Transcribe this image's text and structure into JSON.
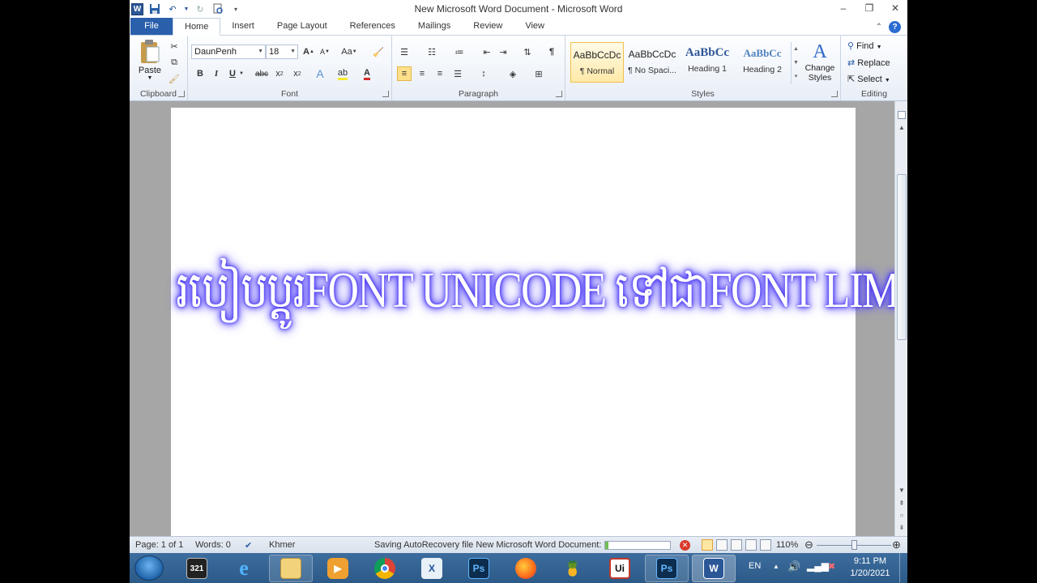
{
  "window": {
    "title": "New Microsoft Word Document  -  Microsoft Word"
  },
  "tabs": [
    "File",
    "Home",
    "Insert",
    "Page Layout",
    "References",
    "Mailings",
    "Review",
    "View"
  ],
  "ribbon": {
    "clipboard": {
      "label": "Clipboard",
      "paste": "Paste"
    },
    "font": {
      "label": "Font",
      "font_name": "DaunPenh",
      "font_size": "18",
      "change_case": "Aa"
    },
    "paragraph": {
      "label": "Paragraph"
    },
    "styles": {
      "label": "Styles",
      "items": [
        {
          "preview": "AaBbCcDc",
          "name": "¶ Normal"
        },
        {
          "preview": "AaBbCcDc",
          "name": "¶ No Spaci..."
        },
        {
          "preview": "AaBbCс",
          "name": "Heading 1"
        },
        {
          "preview": "AaBbCc",
          "name": "Heading 2"
        }
      ],
      "change_styles": "Change Styles"
    },
    "editing": {
      "label": "Editing",
      "find": "Find",
      "replace": "Replace",
      "select": "Select"
    }
  },
  "document": {
    "heading": "របៀបប្ដូរFONT UNICODE ទៅជាFONT LIMON"
  },
  "statusbar": {
    "page": "Page: 1 of 1",
    "words": "Words: 0",
    "language": "Khmer",
    "saving": "Saving AutoRecovery file New Microsoft Word Document:",
    "progress": 0.05,
    "zoom": "110%"
  },
  "taskbar": {
    "language": "EN",
    "time": "9:11 PM",
    "date": "1/20/2021",
    "apps": [
      {
        "name": "start-button"
      },
      {
        "name": "321-player-app",
        "label": "321"
      },
      {
        "name": "internet-explorer-app",
        "label": "e"
      },
      {
        "name": "file-explorer-app",
        "label": ""
      },
      {
        "name": "media-player-app",
        "label": ""
      },
      {
        "name": "chrome-app",
        "label": ""
      },
      {
        "name": "xilisoft-app",
        "label": "X"
      },
      {
        "name": "photoshop-app",
        "label": "Ps"
      },
      {
        "name": "firefox-app",
        "label": ""
      },
      {
        "name": "fruit-app",
        "label": ""
      },
      {
        "name": "unikey-app",
        "label": "Ui"
      },
      {
        "name": "photoshop-open-app",
        "label": "Ps"
      },
      {
        "name": "word-app",
        "label": "W"
      }
    ]
  },
  "colors": {
    "file_tab": "#2a5fac",
    "heading_glow": "#4c3cf0",
    "taskbar": "#2c5a88"
  }
}
